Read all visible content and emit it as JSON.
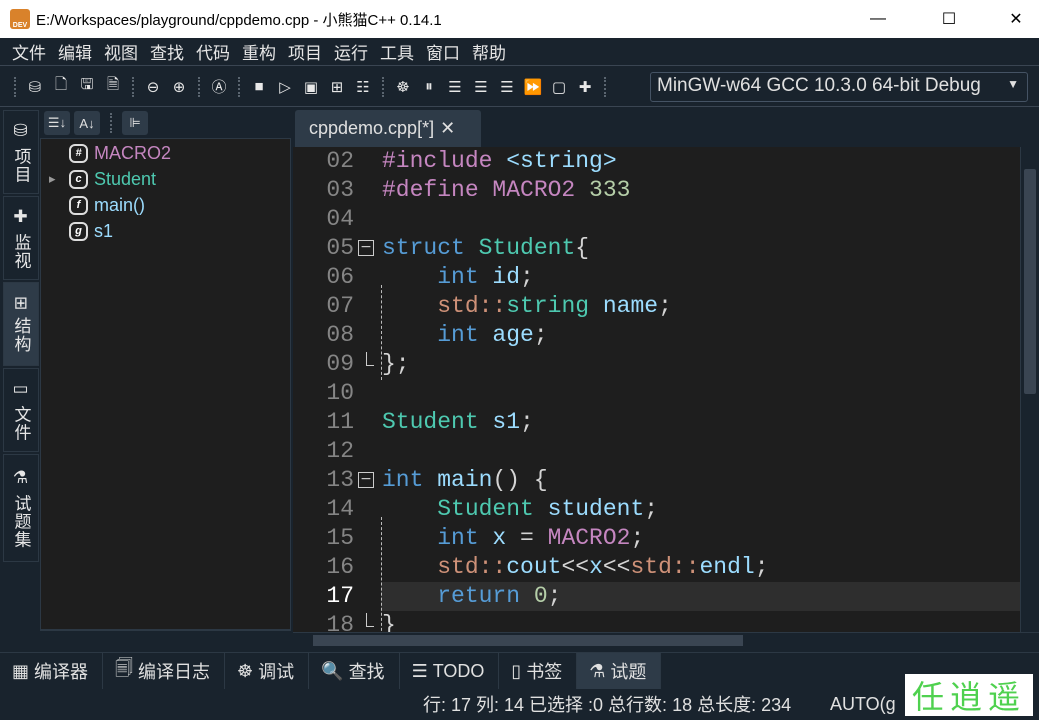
{
  "window": {
    "title": "E:/Workspaces/playground/cppdemo.cpp  - 小熊猫C++ 0.14.1",
    "icon_text": "DEV",
    "minimize": "—",
    "maximize": "☐",
    "close": "✕"
  },
  "menu": [
    "文件",
    "编辑",
    "视图",
    "查找",
    "代码",
    "重构",
    "项目",
    "运行",
    "工具",
    "窗口",
    "帮助"
  ],
  "toolbar": {
    "icons": [
      [
        "database-icon",
        "⛁"
      ],
      [
        "new-file-icon",
        "🗋"
      ],
      [
        "save-icon",
        "🖫"
      ],
      [
        "save-as-icon",
        "🗎"
      ],
      "sep",
      [
        "back-icon",
        "⊖"
      ],
      [
        "forward-icon",
        "⊕"
      ],
      "sep",
      [
        "format-icon",
        "Ⓐ"
      ],
      "sep",
      [
        "compile-icon",
        "■"
      ],
      [
        "run-icon",
        "▷"
      ],
      [
        "compile-run-icon",
        "▣"
      ],
      [
        "rebuild-icon",
        "⊞"
      ],
      [
        "options-icon",
        "☷"
      ],
      "sep",
      [
        "debug-icon",
        "☸"
      ],
      [
        "pause-icon",
        "⏸"
      ],
      [
        "step-over-icon",
        "☰"
      ],
      [
        "step-into-icon",
        "☰"
      ],
      [
        "step-out-icon",
        "☰"
      ],
      [
        "continue-icon",
        "⏩"
      ],
      [
        "stop-icon",
        "▢"
      ],
      [
        "add-watch-icon",
        "✚"
      ]
    ],
    "compiler": "MinGW-w64 GCC 10.3.0 64-bit Debug"
  },
  "side_tabs": [
    {
      "label": "项目",
      "icon": "⛁"
    },
    {
      "label": "监视",
      "icon": "✚"
    },
    {
      "label": "结构",
      "icon": "⊞",
      "active": true
    },
    {
      "label": "文件",
      "icon": "▭"
    },
    {
      "label": "试题集",
      "icon": "⚗"
    }
  ],
  "tree": {
    "toolbar": [
      "☰↓",
      "A↓",
      "⊫"
    ],
    "nodes": [
      {
        "badge": "#",
        "label": "MACRO2",
        "color": "#c586c0",
        "expander": false
      },
      {
        "badge": "c",
        "label": "Student",
        "color": "#4ec9b0",
        "expander": true
      },
      {
        "badge": "f",
        "label": "main()",
        "color": "#9cdcfe",
        "expander": false
      },
      {
        "badge": "g",
        "label": "s1",
        "color": "#9cdcfe",
        "expander": false
      }
    ]
  },
  "editor": {
    "tab_label": "cppdemo.cpp[*]",
    "tab_close": "✕",
    "current_line": "17",
    "lines": [
      {
        "n": "02",
        "t": [
          [
            "#include ",
            "pp"
          ],
          [
            "<string>",
            "id"
          ]
        ]
      },
      {
        "n": "03",
        "t": [
          [
            "#define ",
            "pp"
          ],
          [
            "MACRO2 ",
            "pp"
          ],
          [
            "333",
            "num"
          ]
        ]
      },
      {
        "n": "04",
        "t": []
      },
      {
        "n": "05",
        "fold": true,
        "t": [
          [
            "struct ",
            "kw"
          ],
          [
            "Student",
            "ty"
          ],
          [
            "{",
            "pl"
          ]
        ]
      },
      {
        "n": "06",
        "t": [
          [
            "    int ",
            "kw"
          ],
          [
            "id",
            "id"
          ],
          [
            ";",
            "pl"
          ]
        ]
      },
      {
        "n": "07",
        "t": [
          [
            "    std::",
            "ns"
          ],
          [
            "string ",
            "ty"
          ],
          [
            "name",
            "id"
          ],
          [
            ";",
            "pl"
          ]
        ]
      },
      {
        "n": "08",
        "t": [
          [
            "    int ",
            "kw"
          ],
          [
            "age",
            "id"
          ],
          [
            ";",
            "pl"
          ]
        ]
      },
      {
        "n": "09",
        "t": [
          [
            "};",
            "pl"
          ]
        ]
      },
      {
        "n": "10",
        "t": []
      },
      {
        "n": "11",
        "t": [
          [
            "Student ",
            "ty"
          ],
          [
            "s1",
            "id"
          ],
          [
            ";",
            "pl"
          ]
        ]
      },
      {
        "n": "12",
        "t": []
      },
      {
        "n": "13",
        "fold": true,
        "t": [
          [
            "int ",
            "kw"
          ],
          [
            "main",
            "id"
          ],
          [
            "() {",
            "pl"
          ]
        ]
      },
      {
        "n": "14",
        "t": [
          [
            "    Student ",
            "ty"
          ],
          [
            "student",
            "id"
          ],
          [
            ";",
            "pl"
          ]
        ]
      },
      {
        "n": "15",
        "t": [
          [
            "    int ",
            "kw"
          ],
          [
            "x ",
            "id"
          ],
          [
            "= ",
            "pl"
          ],
          [
            "MACRO2",
            "pp"
          ],
          [
            ";",
            "pl"
          ]
        ]
      },
      {
        "n": "16",
        "t": [
          [
            "    std::",
            "ns"
          ],
          [
            "cout",
            "id"
          ],
          [
            "<<",
            "pl"
          ],
          [
            "x",
            "id"
          ],
          [
            "<<",
            "pl"
          ],
          [
            "std::",
            "ns"
          ],
          [
            "endl",
            "id"
          ],
          [
            ";",
            "pl"
          ]
        ]
      },
      {
        "n": "17",
        "t": [
          [
            "    return ",
            "kw"
          ],
          [
            "0",
            "num"
          ],
          [
            ";",
            "pl"
          ]
        ]
      },
      {
        "n": "18",
        "t": [
          [
            "}",
            "pl"
          ]
        ]
      }
    ]
  },
  "bottom_tabs": [
    {
      "label": "编译器",
      "icon": "▦"
    },
    {
      "label": "编译日志",
      "icon": "🗐"
    },
    {
      "label": "调试",
      "icon": "☸"
    },
    {
      "label": "查找",
      "icon": "🔍"
    },
    {
      "label": "TODO",
      "icon": "☰"
    },
    {
      "label": "书签",
      "icon": "▯"
    },
    {
      "label": "试题",
      "icon": "⚗",
      "active": true
    }
  ],
  "status": {
    "text": "行: 17 列: 14 已选择 :0 总行数: 18 总长度: 234",
    "encoding": "AUTO(g"
  },
  "watermark": "任逍遥"
}
